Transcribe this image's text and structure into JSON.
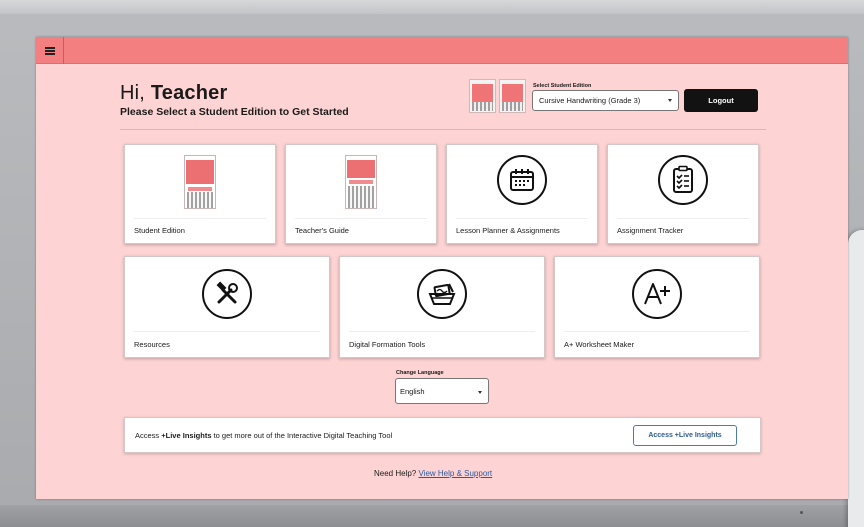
{
  "header": {
    "menu_icon": "hamburger-menu-icon",
    "greeting_prefix": "Hi,",
    "greeting_name": "Teacher",
    "subtitle": "Please Select a Student Edition to Get Started"
  },
  "edition": {
    "label": "Select Student Edition",
    "selected": "Cursive Handwriting (Grade 3)"
  },
  "logout_label": "Logout",
  "cards_row1": [
    {
      "label": "Student Edition",
      "icon": "student-edition-book-icon"
    },
    {
      "label": "Teacher's Guide",
      "icon": "teachers-guide-book-icon"
    },
    {
      "label": "Lesson Planner & Assignments",
      "icon": "calendar-icon"
    },
    {
      "label": "Assignment Tracker",
      "icon": "clipboard-checklist-icon"
    }
  ],
  "cards_row2": [
    {
      "label": "Resources",
      "icon": "wrench-hammer-icon"
    },
    {
      "label": "Digital Formation Tools",
      "icon": "digital-tools-icon"
    },
    {
      "label": "A+ Worksheet Maker",
      "icon": "a-plus-icon"
    }
  ],
  "language": {
    "label": "Change Language",
    "selected": "English"
  },
  "insights": {
    "prefix": "Access ",
    "bold": "+Live Insights",
    "suffix": " to get more out of the Interactive Digital Teaching Tool",
    "button": "Access +Live Insights"
  },
  "help": {
    "text": "Need Help?",
    "link": "View Help & Support"
  },
  "colors": {
    "topbar": "#f37f80",
    "background": "#fdd3d3",
    "logout": "#121212",
    "link": "#2c5aa0"
  }
}
